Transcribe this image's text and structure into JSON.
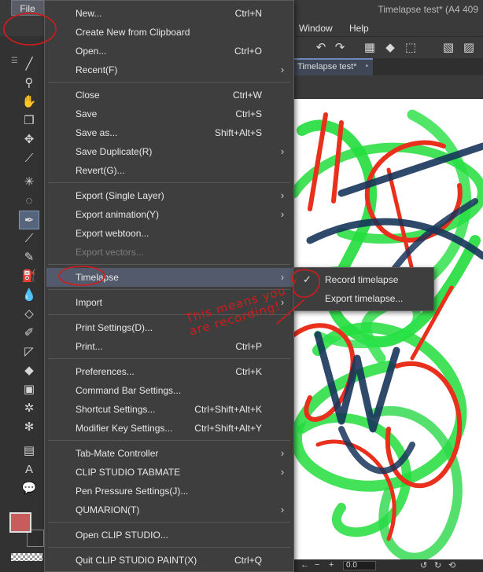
{
  "window": {
    "title": "Timelapse test* (A4 409"
  },
  "menubar": {
    "file": "File",
    "window": "Window",
    "help": "Help"
  },
  "document_tab": {
    "label": "Timelapse test*",
    "close_glyph": "•"
  },
  "file_menu": {
    "items": [
      {
        "label": "New...",
        "shortcut": "Ctrl+N",
        "submenu": false,
        "disabled": false
      },
      {
        "label": "Create New from Clipboard",
        "shortcut": "",
        "submenu": false,
        "disabled": false
      },
      {
        "label": "Open...",
        "shortcut": "Ctrl+O",
        "submenu": false,
        "disabled": false
      },
      {
        "label": "Recent(F)",
        "shortcut": "",
        "submenu": true,
        "disabled": false
      },
      {
        "label": "Close",
        "shortcut": "Ctrl+W",
        "submenu": false,
        "disabled": false
      },
      {
        "label": "Save",
        "shortcut": "Ctrl+S",
        "submenu": false,
        "disabled": false
      },
      {
        "label": "Save as...",
        "shortcut": "Shift+Alt+S",
        "submenu": false,
        "disabled": false
      },
      {
        "label": "Save Duplicate(R)",
        "shortcut": "",
        "submenu": true,
        "disabled": false
      },
      {
        "label": "Revert(G)...",
        "shortcut": "",
        "submenu": false,
        "disabled": false
      },
      {
        "label": "Export (Single Layer)",
        "shortcut": "",
        "submenu": true,
        "disabled": false
      },
      {
        "label": "Export animation(Y)",
        "shortcut": "",
        "submenu": true,
        "disabled": false
      },
      {
        "label": "Export webtoon...",
        "shortcut": "",
        "submenu": false,
        "disabled": false
      },
      {
        "label": "Export vectors...",
        "shortcut": "",
        "submenu": false,
        "disabled": true
      },
      {
        "label": "Timelapse",
        "shortcut": "",
        "submenu": true,
        "disabled": false,
        "highlighted": true
      },
      {
        "label": "Import",
        "shortcut": "",
        "submenu": true,
        "disabled": false
      },
      {
        "label": "Print Settings(D)...",
        "shortcut": "",
        "submenu": false,
        "disabled": false
      },
      {
        "label": "Print...",
        "shortcut": "Ctrl+P",
        "submenu": false,
        "disabled": false
      },
      {
        "label": "Preferences...",
        "shortcut": "Ctrl+K",
        "submenu": false,
        "disabled": false
      },
      {
        "label": "Command Bar Settings...",
        "shortcut": "",
        "submenu": false,
        "disabled": false
      },
      {
        "label": "Shortcut Settings...",
        "shortcut": "Ctrl+Shift+Alt+K",
        "submenu": false,
        "disabled": false
      },
      {
        "label": "Modifier Key Settings...",
        "shortcut": "Ctrl+Shift+Alt+Y",
        "submenu": false,
        "disabled": false
      },
      {
        "label": "Tab-Mate Controller",
        "shortcut": "",
        "submenu": true,
        "disabled": false
      },
      {
        "label": "CLIP STUDIO TABMATE",
        "shortcut": "",
        "submenu": true,
        "disabled": false
      },
      {
        "label": "Pen Pressure Settings(J)...",
        "shortcut": "",
        "submenu": false,
        "disabled": false
      },
      {
        "label": "QUMARION(T)",
        "shortcut": "",
        "submenu": true,
        "disabled": false
      },
      {
        "label": "Open CLIP STUDIO...",
        "shortcut": "",
        "submenu": false,
        "disabled": false
      },
      {
        "label": "Quit CLIP STUDIO PAINT(X)",
        "shortcut": "Ctrl+Q",
        "submenu": false,
        "disabled": false
      }
    ]
  },
  "timelapse_submenu": {
    "items": [
      {
        "label": "Record timelapse",
        "checked": true,
        "check_glyph": "✓"
      },
      {
        "label": "Export timelapse...",
        "checked": false,
        "check_glyph": ""
      }
    ]
  },
  "annotation": {
    "text": "This means you are recording!",
    "color": "#d11c1c"
  },
  "status_bar": {
    "zoom": "0.0"
  },
  "colors": {
    "menu_bg": "#3e3e3e",
    "highlight": "#535a6b",
    "main_color": "#c85b5b",
    "annotation_red": "#d11c1c"
  },
  "icons": {
    "tools": [
      "menu-icon",
      "zoom-icon",
      "hand-icon",
      "cube-icon",
      "move-icon",
      "eyedropper-icon",
      "auto-select-icon",
      "lasso-icon",
      "pen-icon",
      "brush-icon",
      "pencil-icon",
      "airbrush-icon",
      "blend-icon",
      "eraser-icon",
      "decoration-icon",
      "vector-icon",
      "fill-icon",
      "gradient-icon",
      "figure-icon",
      "settings-icon",
      "frame-icon",
      "text-icon",
      "balloon-icon"
    ],
    "toolbar": [
      "undo-icon",
      "redo-icon",
      "clear-icon",
      "fill-bucket-icon",
      "transform-icon",
      "select-all-icon",
      "deselect-icon"
    ]
  }
}
